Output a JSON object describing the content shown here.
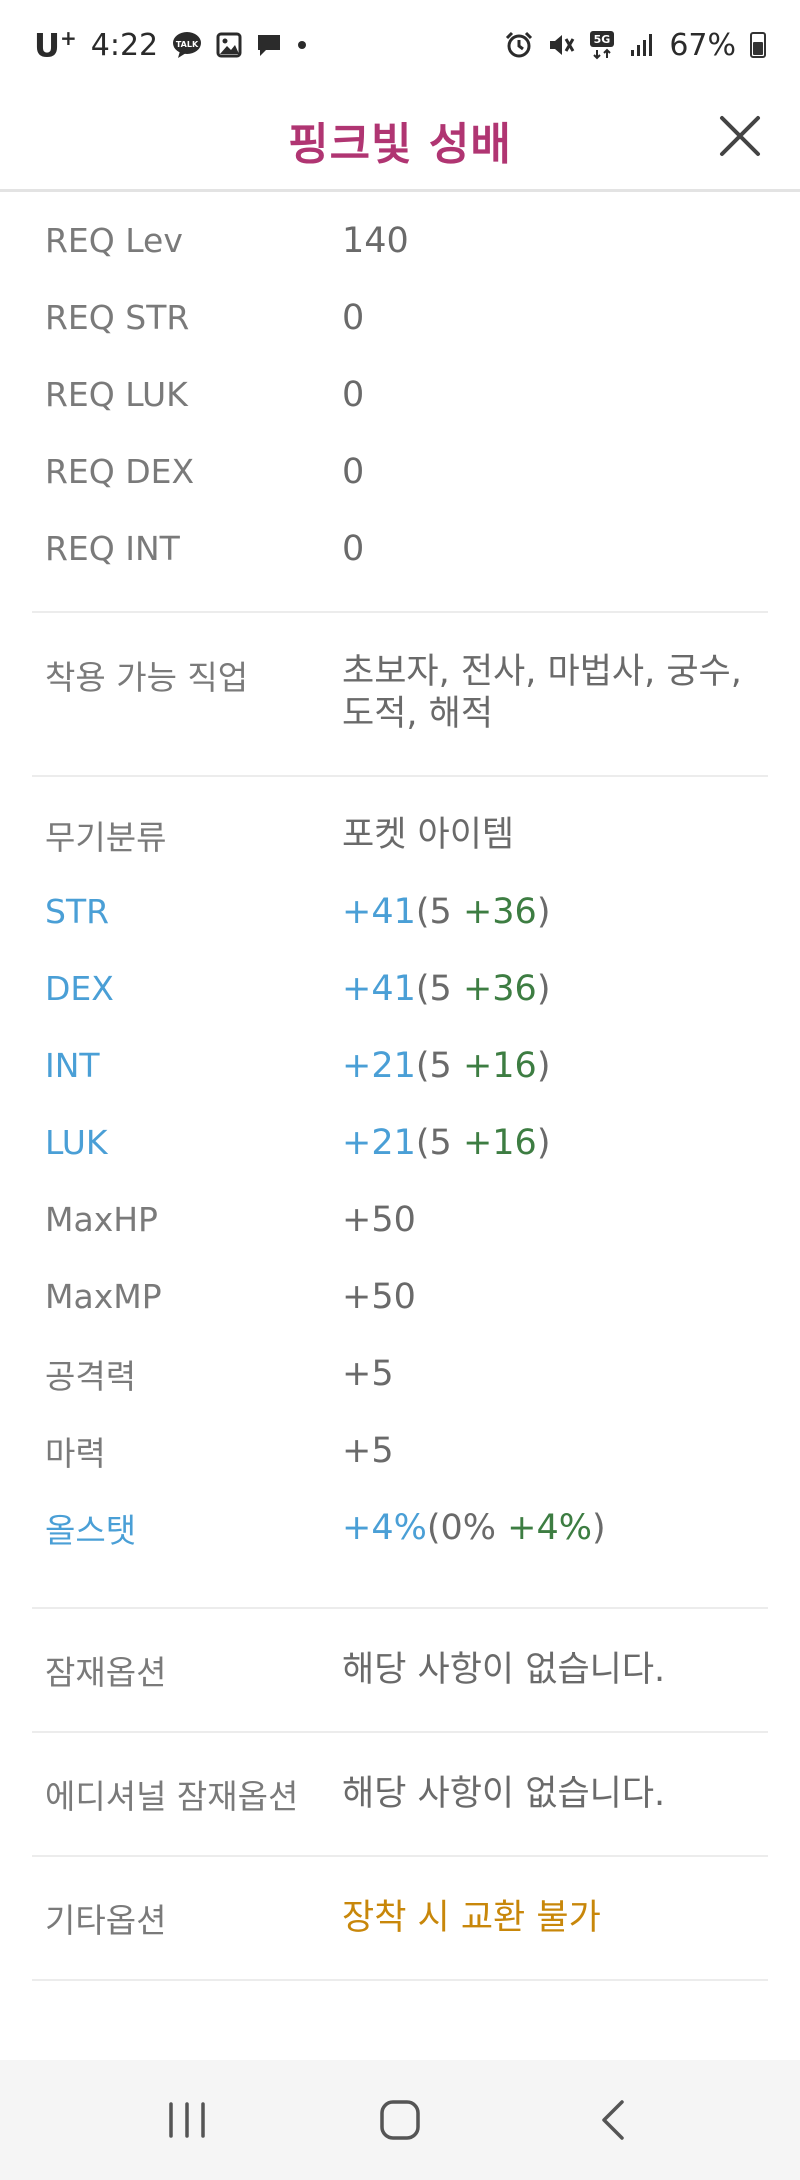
{
  "status_bar": {
    "carrier": "U",
    "carrier_sup": "+",
    "time": "4:22",
    "battery": "67%",
    "network": "5G",
    "icons": [
      "talk-icon",
      "gallery-icon",
      "message-icon",
      "dot-icon",
      "alarm-icon",
      "mute-icon",
      "5g-icon",
      "signal-icon",
      "battery-icon"
    ]
  },
  "header": {
    "title": "핑크빛 성배"
  },
  "requirements": [
    {
      "label": "REQ Lev",
      "value": "140"
    },
    {
      "label": "REQ STR",
      "value": "0"
    },
    {
      "label": "REQ LUK",
      "value": "0"
    },
    {
      "label": "REQ DEX",
      "value": "0"
    },
    {
      "label": "REQ INT",
      "value": "0"
    }
  ],
  "jobs": {
    "label": "착용 가능 직업",
    "value": "초보자, 전사, 마법사, 궁수, 도적, 해적"
  },
  "stats": {
    "weapon_type": {
      "label": "무기분류",
      "value": "포켓 아이템"
    },
    "str": {
      "label": "STR",
      "total": "+41",
      "open": "(5 ",
      "bonus": "+36",
      "close": ")"
    },
    "dex": {
      "label": "DEX",
      "total": "+41",
      "open": "(5 ",
      "bonus": "+36",
      "close": ")"
    },
    "int": {
      "label": "INT",
      "total": "+21",
      "open": "(5 ",
      "bonus": "+16",
      "close": ")"
    },
    "luk": {
      "label": "LUK",
      "total": "+21",
      "open": "(5 ",
      "bonus": "+16",
      "close": ")"
    },
    "maxhp": {
      "label": "MaxHP",
      "value": "+50"
    },
    "maxmp": {
      "label": "MaxMP",
      "value": "+50"
    },
    "attack": {
      "label": "공격력",
      "value": "+5"
    },
    "magic": {
      "label": "마력",
      "value": "+5"
    },
    "allstat": {
      "label": "올스탯",
      "total": "+4%",
      "open": "(0% ",
      "bonus": "+4%",
      "close": ")"
    }
  },
  "potential": {
    "label": "잠재옵션",
    "value": "해당 사항이 없습니다."
  },
  "additional_potential": {
    "label": "에디셔널 잠재옵션",
    "value": "해당 사항이 없습니다."
  },
  "etc": {
    "label": "기타옵션",
    "value": "장착 시 교환 불가"
  },
  "colors": {
    "title": "#b03572",
    "stat_blue": "#4a9fd6",
    "bonus_green": "#3d7d42",
    "etc_orange": "#c8870a"
  }
}
